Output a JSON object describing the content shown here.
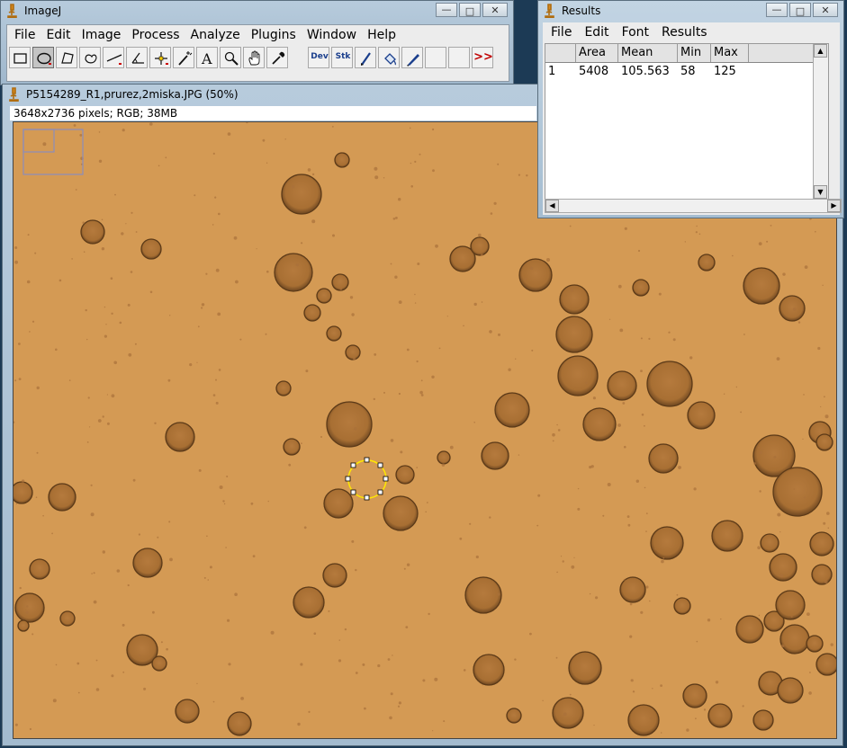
{
  "main_window": {
    "title": "ImageJ",
    "menu": [
      "File",
      "Edit",
      "Image",
      "Process",
      "Analyze",
      "Plugins",
      "Window",
      "Help"
    ],
    "tools": [
      {
        "name": "rectangle-tool",
        "icon": "rectangle-icon"
      },
      {
        "name": "oval-tool",
        "icon": "oval-icon",
        "selected": true
      },
      {
        "name": "polygon-tool",
        "icon": "polygon-icon"
      },
      {
        "name": "freehand-tool",
        "icon": "freehand-icon"
      },
      {
        "name": "line-tool",
        "icon": "line-icon"
      },
      {
        "name": "angle-tool",
        "icon": "angle-icon"
      },
      {
        "name": "point-tool",
        "icon": "crosshair-icon"
      },
      {
        "name": "wand-tool",
        "icon": "wand-icon"
      },
      {
        "name": "text-tool",
        "icon": "text-icon"
      },
      {
        "name": "zoom-tool",
        "icon": "magnifier-icon"
      },
      {
        "name": "hand-tool",
        "icon": "hand-icon"
      },
      {
        "name": "dropper-tool",
        "icon": "dropper-icon"
      }
    ],
    "dev_label": "Dev",
    "stk_label": "Stk",
    "more_label": ">>"
  },
  "image_window": {
    "title": "P5154289_R1,prurez,2miska.JPG (50%)",
    "info": "3648x2736 pixels; RGB; 38MB",
    "background_color": "#d49a54"
  },
  "results_window": {
    "title": "Results",
    "menu": [
      "File",
      "Edit",
      "Font",
      "Results"
    ],
    "columns": [
      "",
      "Area",
      "Mean",
      "Min",
      "Max"
    ],
    "rows": [
      [
        "1",
        "5408",
        "105.563",
        "58",
        "125"
      ]
    ]
  }
}
